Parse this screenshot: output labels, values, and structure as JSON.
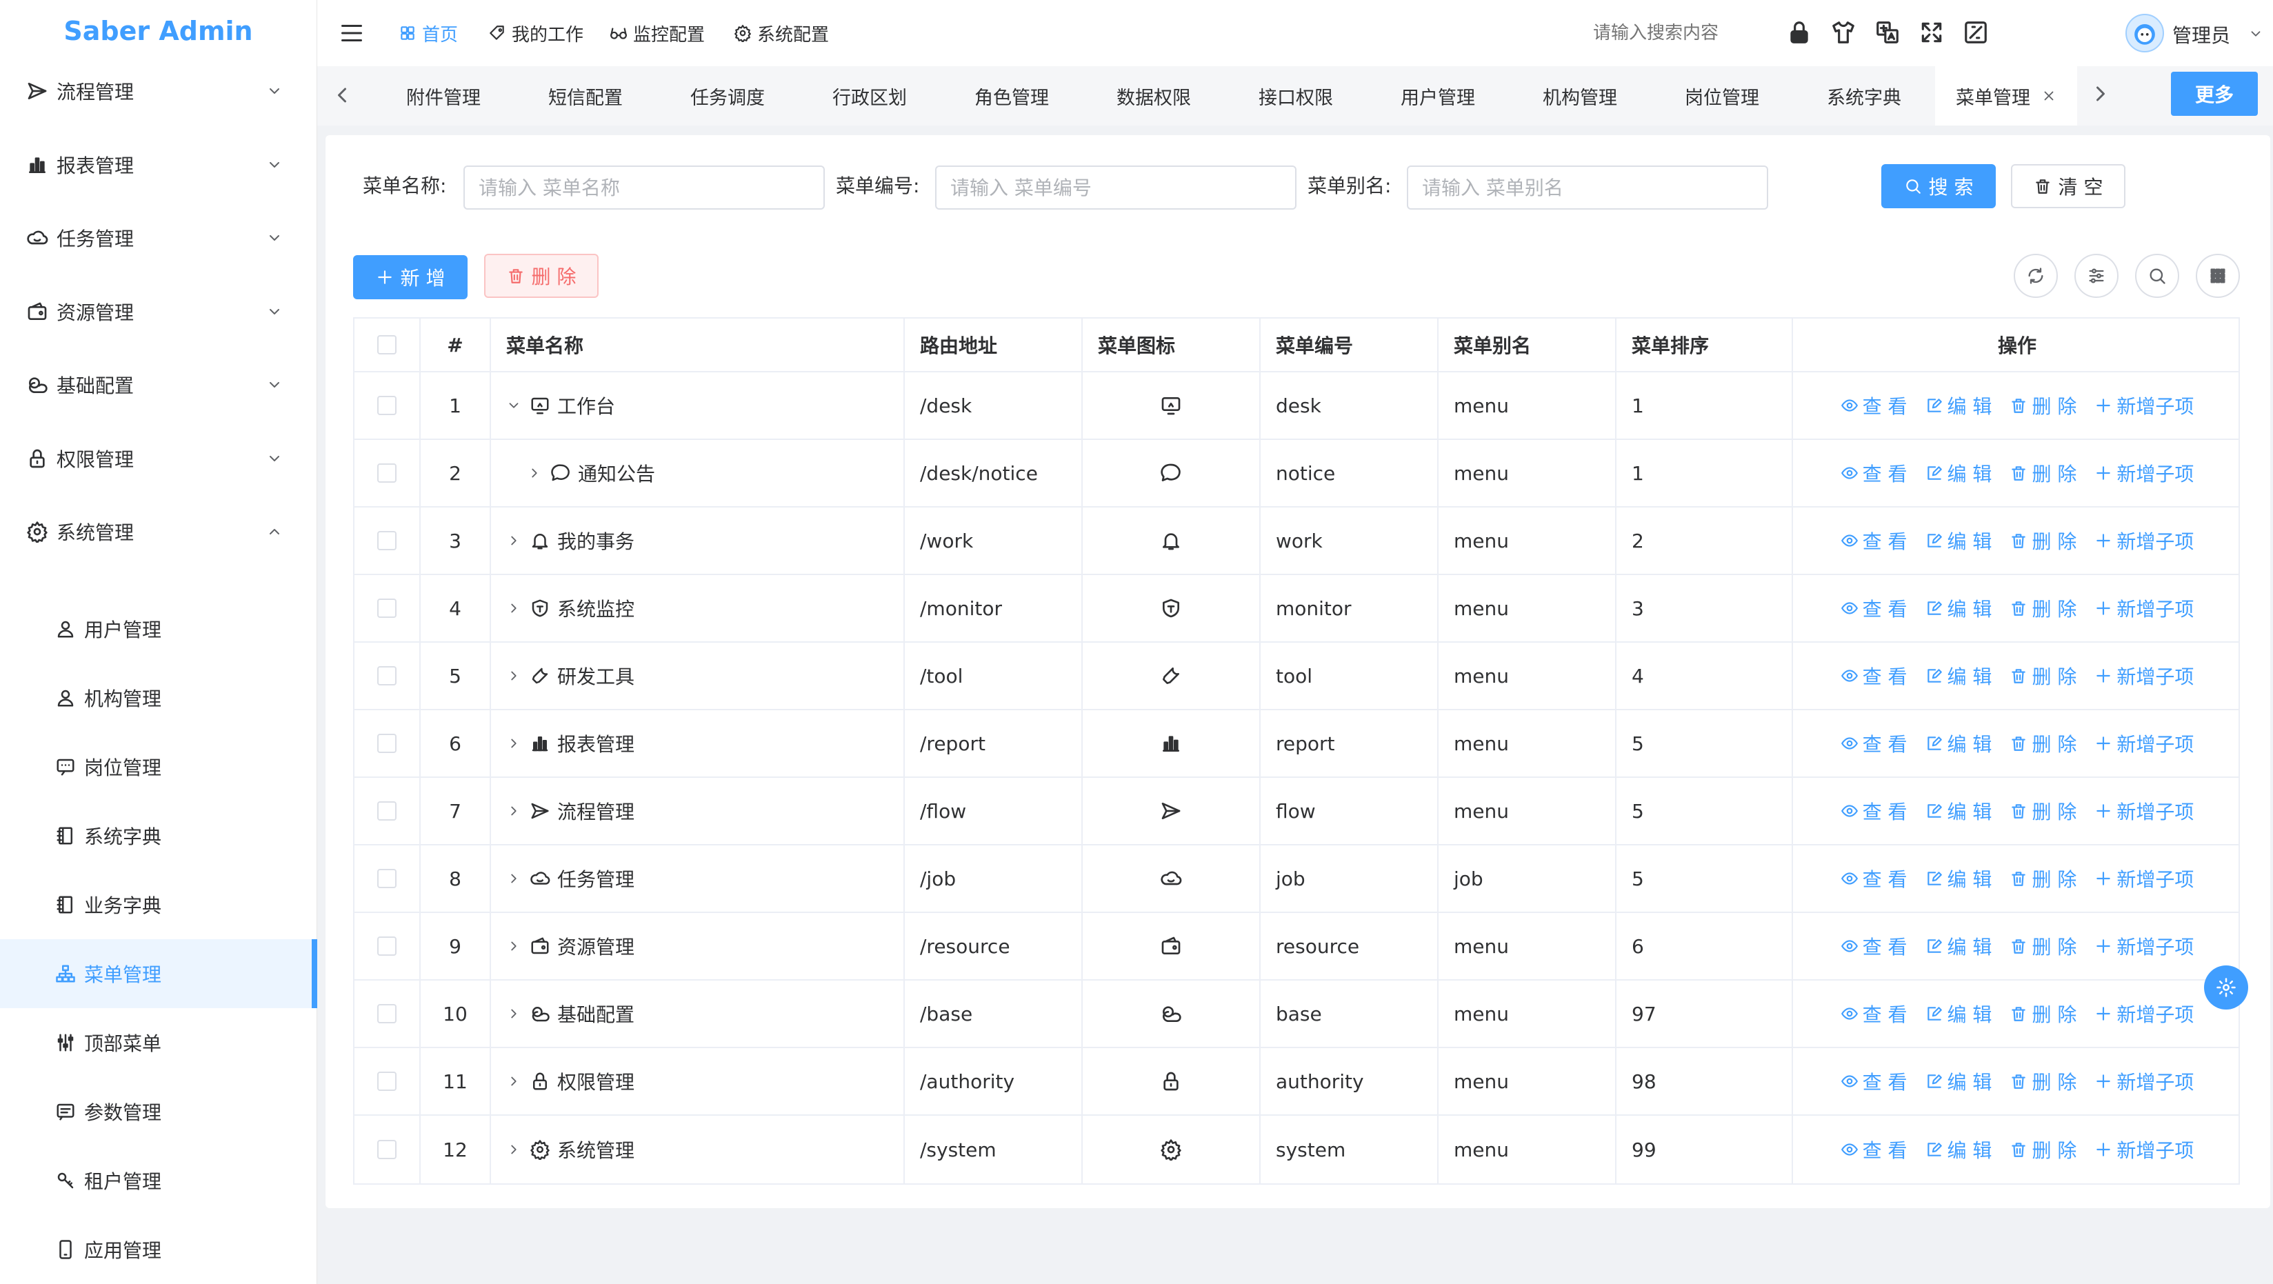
{
  "app": {
    "title": "Saber Admin"
  },
  "sidebar": {
    "menus": [
      {
        "label": "流程管理",
        "icon": "send-icon"
      },
      {
        "label": "报表管理",
        "icon": "bar-chart-icon"
      },
      {
        "label": "任务管理",
        "icon": "cloud-icon"
      },
      {
        "label": "资源管理",
        "icon": "wallet-icon"
      },
      {
        "label": "基础配置",
        "icon": "cloudy-icon"
      },
      {
        "label": "权限管理",
        "icon": "lock-icon"
      },
      {
        "label": "系统管理",
        "icon": "gear-icon"
      }
    ],
    "submenus": [
      {
        "label": "用户管理",
        "icon": "user-icon"
      },
      {
        "label": "机构管理",
        "icon": "user-icon"
      },
      {
        "label": "岗位管理",
        "icon": "chat-icon"
      },
      {
        "label": "系统字典",
        "icon": "notebook-icon"
      },
      {
        "label": "业务字典",
        "icon": "notebook-icon"
      },
      {
        "label": "菜单管理",
        "icon": "sitemap-icon",
        "active": true
      },
      {
        "label": "顶部菜单",
        "icon": "sliders-icon"
      },
      {
        "label": "参数管理",
        "icon": "message-icon"
      },
      {
        "label": "租户管理",
        "icon": "key-icon"
      },
      {
        "label": "应用管理",
        "icon": "phone-icon"
      }
    ]
  },
  "header": {
    "nav": [
      {
        "label": "首页",
        "icon": "grid-icon",
        "active": true
      },
      {
        "label": "我的工作",
        "icon": "tag-icon"
      },
      {
        "label": "监控配置",
        "icon": "glasses-icon"
      },
      {
        "label": "系统配置",
        "icon": "gear-icon"
      }
    ],
    "search_placeholder": "请输入搜索内容",
    "user_name": "管理员"
  },
  "tabs": {
    "items": [
      "附件管理",
      "短信配置",
      "任务调度",
      "行政区划",
      "角色管理",
      "数据权限",
      "接口权限",
      "用户管理",
      "机构管理",
      "岗位管理",
      "系统字典",
      "菜单管理"
    ],
    "active": "菜单管理",
    "more_label": "更多"
  },
  "filters": {
    "name_label": "菜单名称:",
    "name_placeholder": "请输入 菜单名称",
    "code_label": "菜单编号:",
    "code_placeholder": "请输入 菜单编号",
    "alias_label": "菜单别名:",
    "alias_placeholder": "请输入 菜单别名",
    "search_label": "搜 索",
    "clear_label": "清 空"
  },
  "toolbar": {
    "add_label": "新 增",
    "delete_label": "删 除"
  },
  "table": {
    "columns": [
      "#",
      "菜单名称",
      "路由地址",
      "菜单图标",
      "菜单编号",
      "菜单别名",
      "菜单排序",
      "操作"
    ],
    "ops": {
      "view": "查 看",
      "edit": "编 辑",
      "delete": "删 除",
      "add_child": "新增子项"
    },
    "rows": [
      {
        "index": "1",
        "name": "工作台",
        "path": "/desk",
        "icon": "monitor-icon",
        "code": "desk",
        "alias": "menu",
        "sort": "1",
        "expanded": true,
        "level": 0
      },
      {
        "index": "2",
        "name": "通知公告",
        "path": "/desk/notice",
        "icon": "chat-bubble-icon",
        "code": "notice",
        "alias": "menu",
        "sort": "1",
        "expanded": false,
        "level": 1
      },
      {
        "index": "3",
        "name": "我的事务",
        "path": "/work",
        "icon": "bell-icon",
        "code": "work",
        "alias": "menu",
        "sort": "2",
        "expanded": false,
        "level": 0
      },
      {
        "index": "4",
        "name": "系统监控",
        "path": "/monitor",
        "icon": "shield-icon",
        "code": "monitor",
        "alias": "menu",
        "sort": "3",
        "expanded": false,
        "level": 0
      },
      {
        "index": "5",
        "name": "研发工具",
        "path": "/tool",
        "icon": "wrench-icon",
        "code": "tool",
        "alias": "menu",
        "sort": "4",
        "expanded": false,
        "level": 0
      },
      {
        "index": "6",
        "name": "报表管理",
        "path": "/report",
        "icon": "bar-chart-icon",
        "code": "report",
        "alias": "menu",
        "sort": "5",
        "expanded": false,
        "level": 0
      },
      {
        "index": "7",
        "name": "流程管理",
        "path": "/flow",
        "icon": "send-icon",
        "code": "flow",
        "alias": "menu",
        "sort": "5",
        "expanded": false,
        "level": 0
      },
      {
        "index": "8",
        "name": "任务管理",
        "path": "/job",
        "icon": "cloud-icon",
        "code": "job",
        "alias": "job",
        "sort": "5",
        "expanded": false,
        "level": 0
      },
      {
        "index": "9",
        "name": "资源管理",
        "path": "/resource",
        "icon": "wallet-icon",
        "code": "resource",
        "alias": "menu",
        "sort": "6",
        "expanded": false,
        "level": 0
      },
      {
        "index": "10",
        "name": "基础配置",
        "path": "/base",
        "icon": "cloudy-icon",
        "code": "base",
        "alias": "menu",
        "sort": "97",
        "expanded": false,
        "level": 0
      },
      {
        "index": "11",
        "name": "权限管理",
        "path": "/authority",
        "icon": "lock-icon",
        "code": "authority",
        "alias": "menu",
        "sort": "98",
        "expanded": false,
        "level": 0
      },
      {
        "index": "12",
        "name": "系统管理",
        "path": "/system",
        "icon": "gear-icon",
        "code": "system",
        "alias": "menu",
        "sort": "99",
        "expanded": false,
        "level": 0
      }
    ]
  },
  "colors": {
    "primary": "#409eff",
    "danger": "#f56c6c",
    "active_bg": "#ecf5ff"
  }
}
